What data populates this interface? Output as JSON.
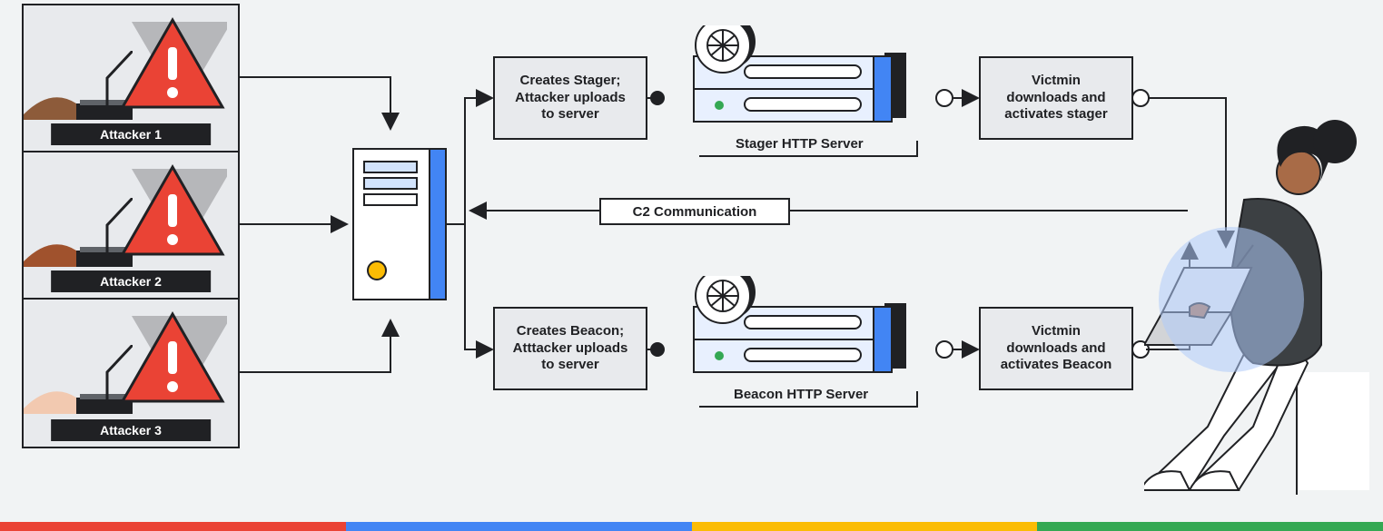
{
  "attackers": [
    "Attacker 1",
    "Attacker 2",
    "Attacker 3"
  ],
  "stager_create": "Creates Stager;\nAttacker uploads\nto server",
  "beacon_create": "Creates Beacon;\nAtttacker uploads\nto server",
  "stager_server": "Stager HTTP Server",
  "beacon_server": "Beacon HTTP Server",
  "c2": "C2 Communication",
  "victim_stager": "Victmin\ndownloads and\nactivates stager",
  "victim_beacon": "Victmin\ndownloads and\nactivates Beacon",
  "footer_colors": [
    "#ea4335",
    "#4285f4",
    "#fbbc04",
    "#34a853"
  ]
}
